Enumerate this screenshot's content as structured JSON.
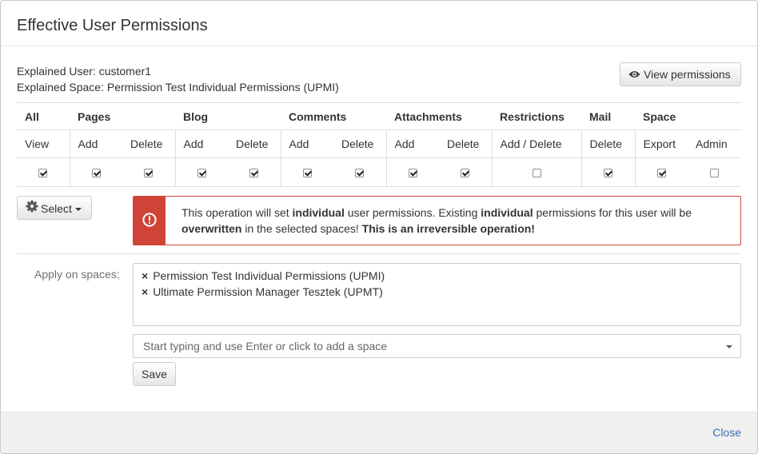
{
  "dialog": {
    "title": "Effective User Permissions"
  },
  "explained": {
    "user_label": "Explained User:",
    "user_value": "customer1",
    "space_label": "Explained Space:",
    "space_value": "Permission Test Individual Permissions (UPMI)"
  },
  "view_permissions_button": {
    "label": "View permissions",
    "icon": "eye-icon"
  },
  "permissions_table": {
    "groups": [
      "All",
      "Pages",
      "Blog",
      "Comments",
      "Attachments",
      "Restrictions",
      "Mail",
      "Space"
    ],
    "columns": [
      {
        "label": "View",
        "checked": true
      },
      {
        "label": "Add",
        "checked": true
      },
      {
        "label": "Delete",
        "checked": true
      },
      {
        "label": "Add",
        "checked": true
      },
      {
        "label": "Delete",
        "checked": true
      },
      {
        "label": "Add",
        "checked": true
      },
      {
        "label": "Delete",
        "checked": true
      },
      {
        "label": "Add",
        "checked": true
      },
      {
        "label": "Delete",
        "checked": true
      },
      {
        "label": "Add / Delete",
        "checked": false
      },
      {
        "label": "Delete",
        "checked": true
      },
      {
        "label": "Export",
        "checked": true
      },
      {
        "label": "Admin",
        "checked": false
      }
    ]
  },
  "select_button": {
    "label": "Select",
    "icon": "gear-icon"
  },
  "warning": {
    "icon": "exclamation-icon",
    "color": "#d04437",
    "part1": "This operation will set ",
    "bold1": "individual",
    "part2": " user permissions. Existing ",
    "bold2": "individual",
    "part3": " permissions for this user will be ",
    "bold3": "overwritten",
    "part4": " in the selected spaces! ",
    "bold4": "This is an irreversible operation!"
  },
  "apply": {
    "label": "Apply on spaces:",
    "spaces": [
      "Permission Test Individual Permissions (UPMI)",
      "Ultimate Permission Manager Tesztek (UPMT)"
    ],
    "remove_glyph": "×",
    "input_placeholder": "Start typing and use Enter or click to add a space"
  },
  "save_button": {
    "label": "Save"
  },
  "footer": {
    "close_label": "Close",
    "link_color": "#3b73af"
  }
}
